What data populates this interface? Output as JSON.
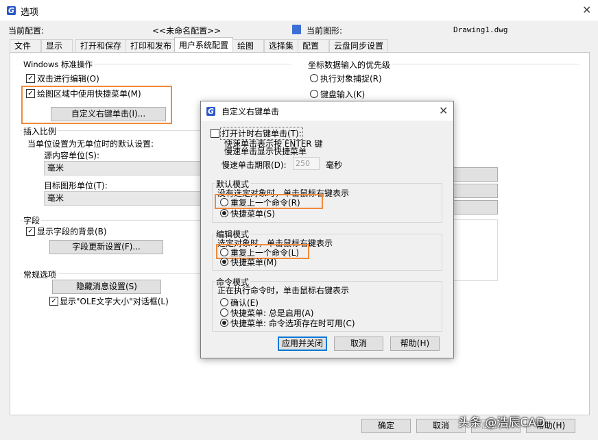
{
  "window": {
    "title": "选项",
    "current_profile_label": "当前配置:",
    "current_profile_value": "<<未命名配置>>",
    "current_drawing_label": "当前图形:",
    "current_drawing_value": "Drawing1.dwg"
  },
  "tabs": [
    "文件",
    "显示",
    "打开和保存",
    "打印和发布",
    "用户系统配置",
    "绘图",
    "选择集",
    "配置",
    "云盘同步设置"
  ],
  "active_tab": "用户系统配置",
  "windows_group": {
    "title": "Windows 标准操作",
    "double_click_edit": "双击进行编辑(O)",
    "shortcut_menu": "绘图区域中使用快捷菜单(M)",
    "custom_right_click_btn": "自定义右键单击(I)..."
  },
  "insert_scale": {
    "title": "插入比例",
    "desc": "当单位设置为无单位时的默认设置:",
    "source_label": "源内容单位(S):",
    "source_value": "毫米",
    "target_label": "目标图形单位(T):",
    "target_value": "毫米"
  },
  "fields": {
    "title": "字段",
    "show_background": "显示字段的背景(B)",
    "update_btn": "字段更新设置(F)..."
  },
  "general": {
    "title": "常规选项",
    "hide_msg_btn": "隐藏消息设置(S)",
    "show_ole": "显示\"OLE文字大小\"对话框(L)"
  },
  "coord_group": {
    "title": "坐标数据输入的优先级",
    "opt1": "执行对象捕捉(R)",
    "opt2": "键盘输入(K)"
  },
  "bottom_buttons": {
    "ok": "确定",
    "cancel": "取消",
    "apply": "应用(A)",
    "help": "帮助(H)"
  },
  "dialog": {
    "title": "自定义右键单击",
    "timed_right_click": "打开计时右键单击(T):",
    "quick_line": "快速单击表示按 ENTER 键",
    "slow_line": "慢速单击显示快捷菜单",
    "slow_period_label": "慢速单击期限(D):",
    "slow_period_value": "250",
    "slow_period_unit": "毫秒",
    "default_mode": {
      "title": "默认模式",
      "desc": "没有选定对象时，单击鼠标右键表示",
      "opt1": "重复上一个命令(R)",
      "opt2": "快捷菜单(S)"
    },
    "edit_mode": {
      "title": "编辑模式",
      "desc": "选定对象时，单击鼠标右键表示",
      "opt1": "重复上一个命令(L)",
      "opt2": "快捷菜单(M)"
    },
    "command_mode": {
      "title": "命令模式",
      "desc": "正在执行命令时，单击鼠标右键表示",
      "opt1": "确认(E)",
      "opt2": "快捷菜单: 总是启用(A)",
      "opt3": "快捷菜单: 命令选项存在时可用(C)"
    },
    "apply_close_btn": "应用并关闭",
    "cancel_btn": "取消",
    "help_btn": "帮助(H)"
  },
  "watermark": "头条 @浩辰CAD",
  "colors": {
    "highlight": "#f0893a",
    "app_icon": "#2b57c9"
  }
}
